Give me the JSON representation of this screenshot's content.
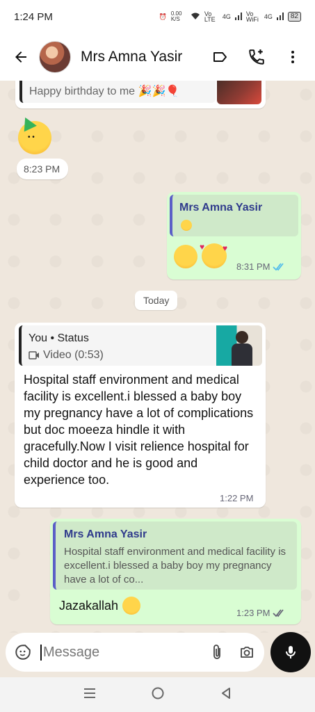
{
  "status_bar": {
    "time": "1:24 PM",
    "net_speed": "0.00 K/S",
    "sim1": "Vo LTE",
    "sim1_net": "4G",
    "sim2": "Vo WiFi",
    "sim2_net": "4G",
    "battery": "82"
  },
  "header": {
    "contact_name": "Mrs Amna Yasir"
  },
  "messages": {
    "m1_quote_text": "Happy birthday to me 🎉🎉🎈",
    "m1_time": "8:23 PM",
    "m2_quote_name": "Mrs Amna Yasir",
    "m2_time": "8:31 PM",
    "date_divider": "Today",
    "m3_quote_name": "You • Status",
    "m3_quote_sub": "Video (0:53)",
    "m3_text": "Hospital staff environment and medical facility is excellent.i blessed a baby boy my pregnancy have a lot of complications but doc moeeza hindle it with gracefully.Now I visit relience hospital for child doctor and he is good and experience too.",
    "m3_time": "1:22 PM",
    "m4_quote_name": "Mrs Amna Yasir",
    "m4_quote_text": "Hospital staff environment and medical facility is excellent.i blessed a baby boy my pregnancy have a lot of co...",
    "m4_text": "Jazakallah",
    "m4_time": "1:23 PM"
  },
  "composer": {
    "placeholder": "Message"
  },
  "colors": {
    "outgoing_bubble": "#d9fdd3",
    "incoming_bubble": "#ffffff",
    "chat_bg": "#efe7dd",
    "read_ticks": "#53bdeb",
    "quote_bar_out": "#5b5fc7"
  },
  "icons": [
    "back-arrow-icon",
    "label-icon",
    "add-call-icon",
    "more-vert-icon",
    "sticker-icon",
    "attach-icon",
    "camera-icon",
    "mic-icon",
    "double-check-icon",
    "video-icon"
  ]
}
